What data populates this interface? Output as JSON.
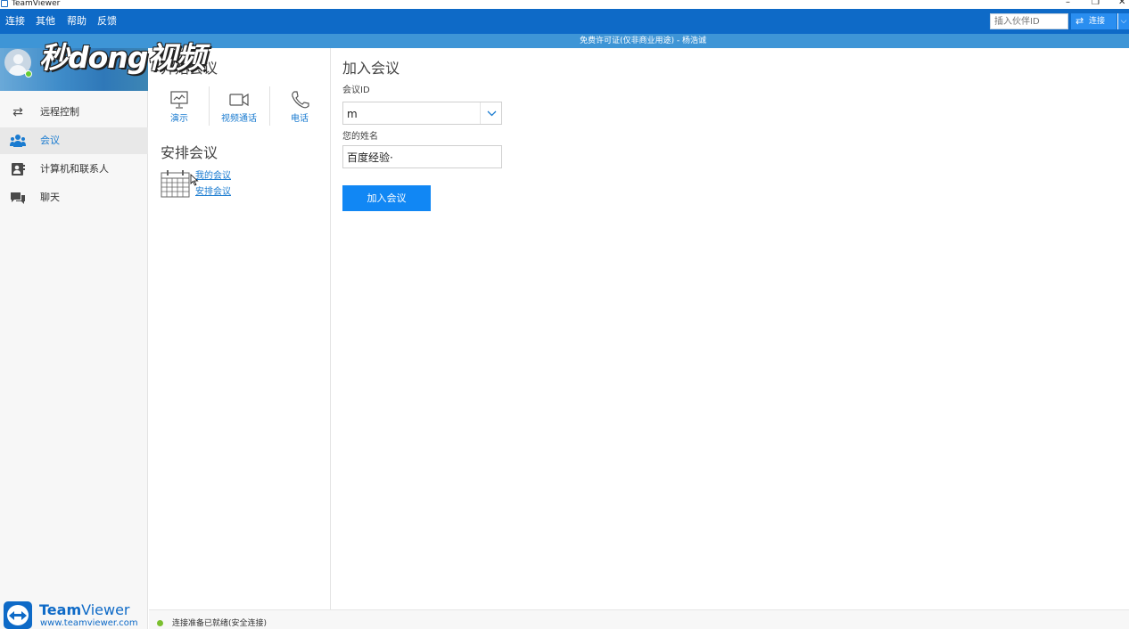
{
  "window": {
    "title": "TeamViewer",
    "controls": [
      "–",
      "❐",
      "✕"
    ]
  },
  "menu": {
    "items": [
      "连接",
      "其他",
      "帮助",
      "反馈"
    ],
    "partner_id_placeholder": "插入伙伴ID",
    "connect_label": "连接"
  },
  "license_text": "免费许可证(仅非商业用途) - 杨浩诚",
  "watermark_text": "秒dong视频",
  "sidebar": {
    "items": [
      {
        "label": "远程控制",
        "icon": "arrows-icon",
        "active": false
      },
      {
        "label": "会议",
        "icon": "meeting-icon",
        "active": true
      },
      {
        "label": "计算机和联系人",
        "icon": "contacts-icon",
        "active": false
      },
      {
        "label": "聊天",
        "icon": "chat-icon",
        "active": false
      }
    ]
  },
  "start_meeting": {
    "title": "开始会议",
    "actions": [
      {
        "label": "演示",
        "icon": "presentation-icon"
      },
      {
        "label": "视频通话",
        "icon": "video-camera-icon"
      },
      {
        "label": "电话",
        "icon": "phone-icon"
      }
    ]
  },
  "schedule_meeting": {
    "title": "安排会议",
    "links": [
      "我的会议",
      "安排会议"
    ]
  },
  "join_meeting": {
    "title": "加入会议",
    "id_label": "会议ID",
    "id_value": "m",
    "name_label": "您的姓名",
    "name_value": "百度经验·",
    "button_label": "加入会议"
  },
  "branding": {
    "name_bold": "Team",
    "name_light": "Viewer",
    "url": "www.teamviewer.com"
  },
  "status": {
    "text": "连接准备已就绪(安全连接)",
    "color": "#7bbf2f"
  },
  "colors": {
    "brand": "#0e6ac7",
    "accent": "#1187f4",
    "link": "#1a7bd0"
  }
}
